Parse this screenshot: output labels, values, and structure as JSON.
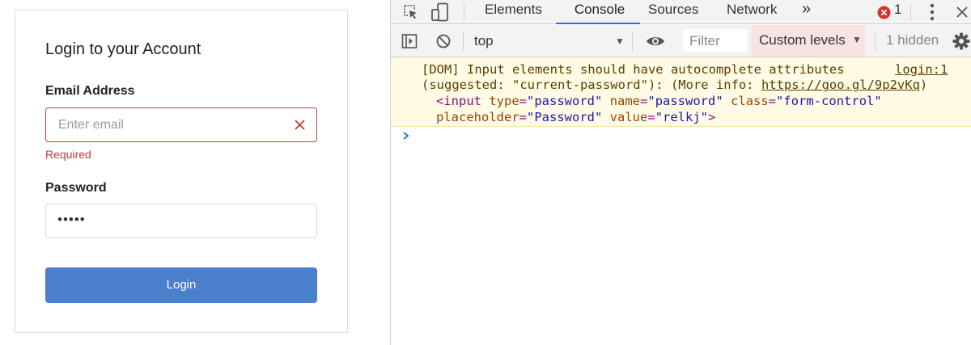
{
  "login": {
    "title": "Login to your Account",
    "email_label": "Email Address",
    "email_placeholder": "Enter email",
    "email_error": "Required",
    "password_label": "Password",
    "password_value": "•••••",
    "login_button": "Login"
  },
  "devtools": {
    "tabs": [
      {
        "label": "Elements"
      },
      {
        "label": "Console",
        "active": true
      },
      {
        "label": "Sources"
      },
      {
        "label": "Network"
      }
    ],
    "more_tabs": "»",
    "error_count": "1",
    "context": "top",
    "filter_placeholder": "Filter",
    "levels": "Custom levels",
    "hidden": "1 hidden",
    "warning": {
      "line1": "[DOM] Input elements should have autocomplete attributes",
      "line2_prefix": "(suggested: \"current-password\"): (More info: ",
      "line2_link": "https://goo.gl/9p2vKq",
      "line2_suffix": ")",
      "source": "login:1",
      "code": {
        "tag_open": "<input",
        "type_attr": "type",
        "type_val": "\"password\"",
        "name_attr": "name",
        "name_val": "\"password\"",
        "class_attr": "class",
        "class_val": "\"form-control\"",
        "placeholder_attr": "placeholder",
        "placeholder_val": "\"Password\"",
        "value_attr": "value",
        "value_val": "\"relkj\"",
        "tag_close": ">"
      }
    }
  },
  "colors": {
    "error_red": "#c33b3b",
    "primary_blue": "#4a7fcb",
    "devtools_active_tab": "#1a73e8",
    "warning_bg": "#fffbe5"
  },
  "icons": [
    "inspect-icon",
    "device-toolbar-icon",
    "error-icon",
    "kebab-menu-icon",
    "sidebar-toggle-icon",
    "clear-console-icon",
    "eye-icon",
    "settings-gear-icon",
    "clear-input-icon",
    "console-prompt-icon"
  ]
}
